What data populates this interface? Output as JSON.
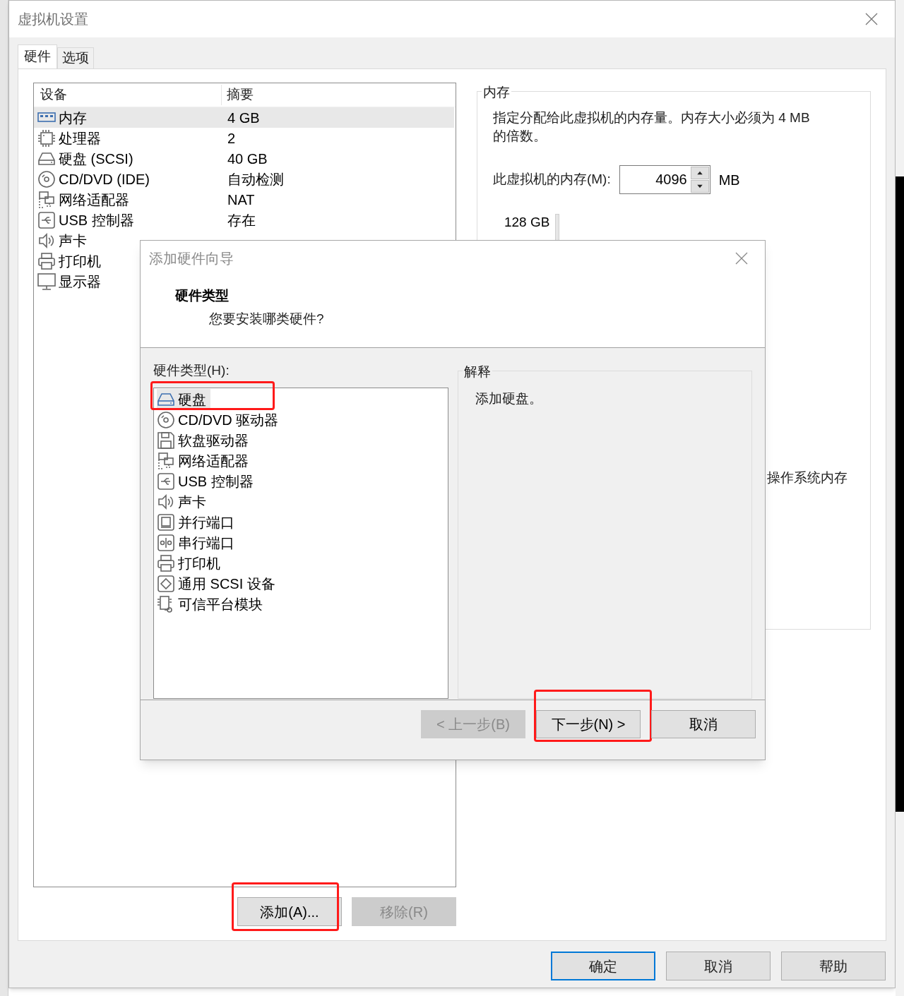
{
  "window": {
    "title": "虚拟机设置"
  },
  "tabs": [
    {
      "label": "硬件",
      "selected": true
    },
    {
      "label": "选项",
      "selected": false
    }
  ],
  "device_list": {
    "columns": [
      "设备",
      "摘要"
    ],
    "rows": [
      {
        "kind": "memory",
        "device": "内存",
        "summary": "4 GB",
        "selected": true
      },
      {
        "kind": "cpu",
        "device": "处理器",
        "summary": "2",
        "selected": false
      },
      {
        "kind": "disk",
        "device": "硬盘 (SCSI)",
        "summary": "40 GB",
        "selected": false
      },
      {
        "kind": "cd",
        "device": "CD/DVD (IDE)",
        "summary": "自动检测",
        "selected": false
      },
      {
        "kind": "network",
        "device": "网络适配器",
        "summary": "NAT",
        "selected": false
      },
      {
        "kind": "usb",
        "device": "USB 控制器",
        "summary": "存在",
        "selected": false
      },
      {
        "kind": "sound",
        "device": "声卡",
        "selected": false
      },
      {
        "kind": "printer",
        "device": "打印机",
        "selected": false
      },
      {
        "kind": "display",
        "device": "显示器",
        "selected": false
      }
    ]
  },
  "device_buttons": [
    {
      "label": "添加(A)...",
      "disabled": false,
      "highlighted": true
    },
    {
      "label": "移除(R)",
      "disabled": true,
      "highlighted": false
    }
  ],
  "memory": {
    "title": "内存",
    "description": "指定分配给此虚拟机的内存量。内存大小必须为 4 MB 的倍数。",
    "field_label": "此虚拟机的内存(M):",
    "value": "4096",
    "unit": "MB",
    "scale_top": "128 GB",
    "legend_text": "操作系统内存"
  },
  "footer_buttons": [
    {
      "label": "确定",
      "default": true
    },
    {
      "label": "取消",
      "default": false
    },
    {
      "label": "帮助",
      "default": false
    }
  ],
  "wizard": {
    "title": "添加硬件向导",
    "heading": "硬件类型",
    "subheading": "您要安装哪类硬件?",
    "list_label": "硬件类型(H):",
    "items": [
      {
        "kind": "disk",
        "label": "硬盘",
        "selected": true,
        "highlighted": true
      },
      {
        "kind": "cd",
        "label": "CD/DVD 驱动器",
        "selected": false,
        "highlighted": false
      },
      {
        "kind": "floppy",
        "label": "软盘驱动器",
        "selected": false,
        "highlighted": false
      },
      {
        "kind": "network",
        "label": "网络适配器",
        "selected": false,
        "highlighted": false
      },
      {
        "kind": "usb",
        "label": "USB 控制器",
        "selected": false,
        "highlighted": false
      },
      {
        "kind": "sound",
        "label": "声卡",
        "selected": false,
        "highlighted": false
      },
      {
        "kind": "parallel",
        "label": "并行端口",
        "selected": false,
        "highlighted": false
      },
      {
        "kind": "serial",
        "label": "串行端口",
        "selected": false,
        "highlighted": false
      },
      {
        "kind": "printer",
        "label": "打印机",
        "selected": false,
        "highlighted": false
      },
      {
        "kind": "scsi",
        "label": "通用 SCSI 设备",
        "selected": false,
        "highlighted": false
      },
      {
        "kind": "tpm",
        "label": "可信平台模块",
        "selected": false,
        "highlighted": false
      }
    ],
    "explanation_title": "解释",
    "explanation": "添加硬盘。",
    "buttons": [
      {
        "label": "< 上一步(B)",
        "disabled": true,
        "highlighted": false
      },
      {
        "label": "下一步(N) >",
        "disabled": false,
        "highlighted": true
      },
      {
        "label": "取消",
        "disabled": false,
        "highlighted": false
      }
    ]
  }
}
